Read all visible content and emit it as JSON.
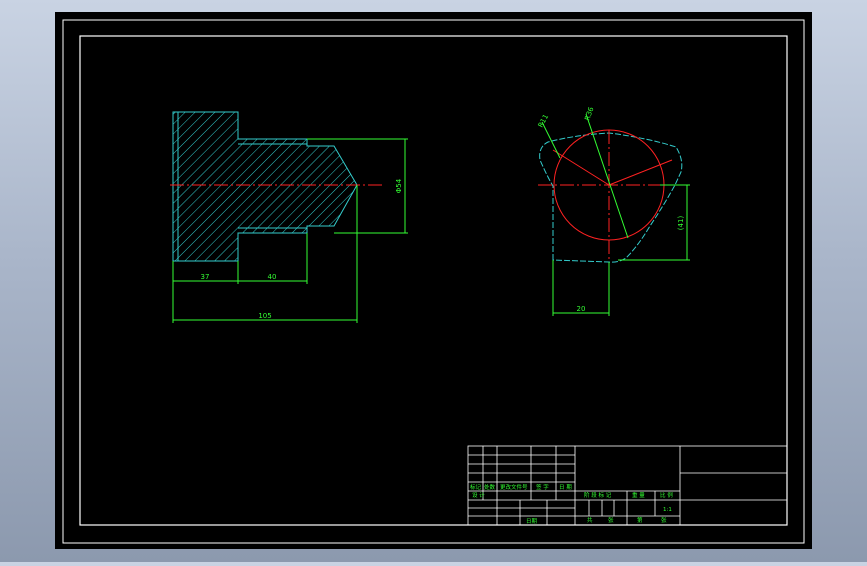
{
  "colors": {
    "background": "#000000",
    "frame": "#ffffff",
    "hatch": "#33cccc",
    "dimension": "#33ff33",
    "centerline": "#ff2222",
    "title_block_text": "#33ff33"
  },
  "front_view": {
    "dim_length_left": "37",
    "dim_length_mid": "40",
    "dim_total_length": "105",
    "dim_diameter": "Φ54"
  },
  "side_view": {
    "dim_radius_small": "R11",
    "dim_radius_large": "R36",
    "dim_height": "(41)",
    "dim_width": "20"
  },
  "title_block": {
    "header_cells": [
      "标记",
      "处数",
      "更改文件号",
      "签 字",
      "日 期"
    ],
    "row_design": "设 计",
    "row_approve": "日期",
    "stage_labels": [
      "阶 段 标 记",
      "重 量",
      "比 例"
    ],
    "scale_value": "1:1",
    "sheet_labels": [
      "共",
      "张",
      "第",
      "张"
    ]
  }
}
